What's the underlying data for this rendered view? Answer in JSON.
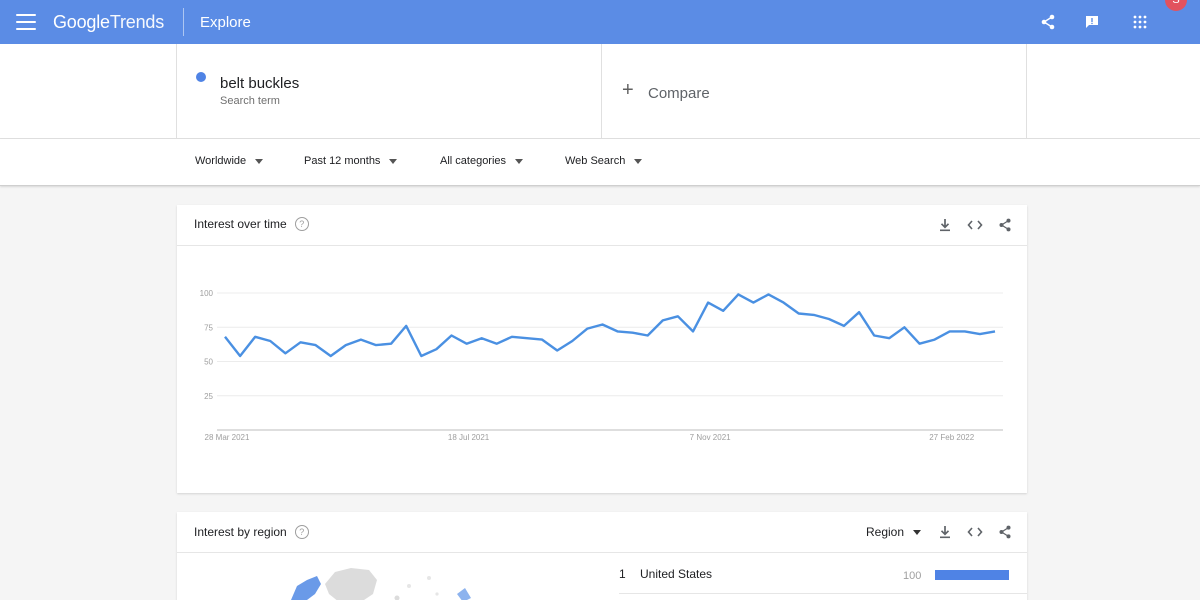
{
  "header": {
    "logo_google": "Google",
    "logo_trends": "Trends",
    "section": "Explore",
    "avatar_initial": "S",
    "accent": "#5b8ce5"
  },
  "search_term": {
    "name": "belt buckles",
    "label": "Search term",
    "color": "#4f83e5"
  },
  "compare": {
    "label": "Compare"
  },
  "filters": {
    "region": "Worldwide",
    "time": "Past 12 months",
    "category": "All categories",
    "type": "Web Search"
  },
  "interest_over_time": {
    "title": "Interest over time",
    "help": "?"
  },
  "chart_data": {
    "type": "line",
    "title": "",
    "xlabel": "",
    "ylabel": "",
    "ylim": [
      0,
      100
    ],
    "y_ticks": [
      25,
      50,
      75,
      100
    ],
    "x_tick_labels": [
      "28 Mar 2021",
      "18 Jul 2021",
      "7 Nov 2021",
      "27 Feb 2022"
    ],
    "x_tick_index": [
      0,
      16,
      32,
      48
    ],
    "grid": true,
    "legend": "none",
    "series": [
      {
        "color": "#4a90e2",
        "values": [
          68,
          54,
          68,
          65,
          56,
          64,
          62,
          54,
          62,
          66,
          62,
          63,
          76,
          54,
          59,
          69,
          63,
          67,
          63,
          68,
          67,
          66,
          58,
          65,
          74,
          77,
          72,
          71,
          69,
          80,
          83,
          72,
          93,
          87,
          99,
          93,
          99,
          93,
          85,
          84,
          81,
          76,
          86,
          69,
          67,
          75,
          63,
          66,
          72,
          72,
          70,
          72
        ]
      }
    ]
  },
  "interest_by_region": {
    "title": "Interest by region",
    "help": "?",
    "resolution": "Region",
    "rows": [
      {
        "rank": "1",
        "name": "United States",
        "value": "100",
        "fraction": 1.0
      }
    ]
  }
}
